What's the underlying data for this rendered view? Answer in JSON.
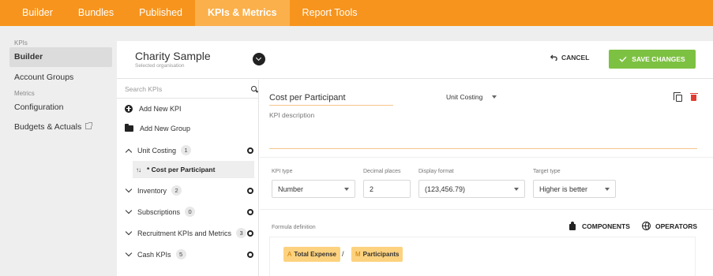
{
  "nav": {
    "items": [
      "Builder",
      "Bundles",
      "Published",
      "KPIs & Metrics",
      "Report Tools"
    ],
    "active_index": 3
  },
  "sidebar": {
    "section_kpis": "KPIs",
    "builder": "Builder",
    "account_groups": "Account Groups",
    "section_metrics": "Metrics",
    "configuration": "Configuration",
    "budgets_actuals": "Budgets & Actuals"
  },
  "header": {
    "org_name": "Charity Sample",
    "org_subtitle": "Selected organisation",
    "cancel_label": "CANCEL",
    "save_label": "SAVE CHANGES"
  },
  "kpi_list": {
    "search_placeholder": "Search KPIs",
    "add_kpi": "Add New KPI",
    "add_group": "Add New Group",
    "groups": [
      {
        "name": "Unit Costing",
        "count": "1",
        "expanded": true
      },
      {
        "name": "Inventory",
        "count": "2",
        "expanded": false
      },
      {
        "name": "Subscriptions",
        "count": "0",
        "expanded": false
      },
      {
        "name": "Recruitment KPIs and Metrics",
        "count": "3",
        "expanded": false
      },
      {
        "name": "Cash KPIs",
        "count": "5",
        "expanded": false
      }
    ],
    "selected_kpi": "* Cost per Participant"
  },
  "editor": {
    "kpi_name": "Cost per Participant",
    "group": "Unit Costing",
    "description_placeholder": "KPI description",
    "kpi_type_label": "KPI type",
    "kpi_type": "Number",
    "decimal_label": "Decimal places",
    "decimal_value": "2",
    "format_label": "Display format",
    "format_value": "(123,456.79)",
    "target_label": "Target type",
    "target_value": "Higher is better",
    "formula_label": "Formula definition",
    "components_label": "COMPONENTS",
    "operators_label": "OPERATORS",
    "formula": [
      {
        "tag": "A",
        "label": "Total Expense"
      },
      {
        "operator": "/"
      },
      {
        "tag": "M",
        "label": "Participants"
      }
    ]
  },
  "colors": {
    "nav_bg": "#f7941d",
    "nav_active": "#fbb04c",
    "save_green": "#7dc142",
    "token_bg": "#fdd27f",
    "delete_red": "#e03c31"
  }
}
